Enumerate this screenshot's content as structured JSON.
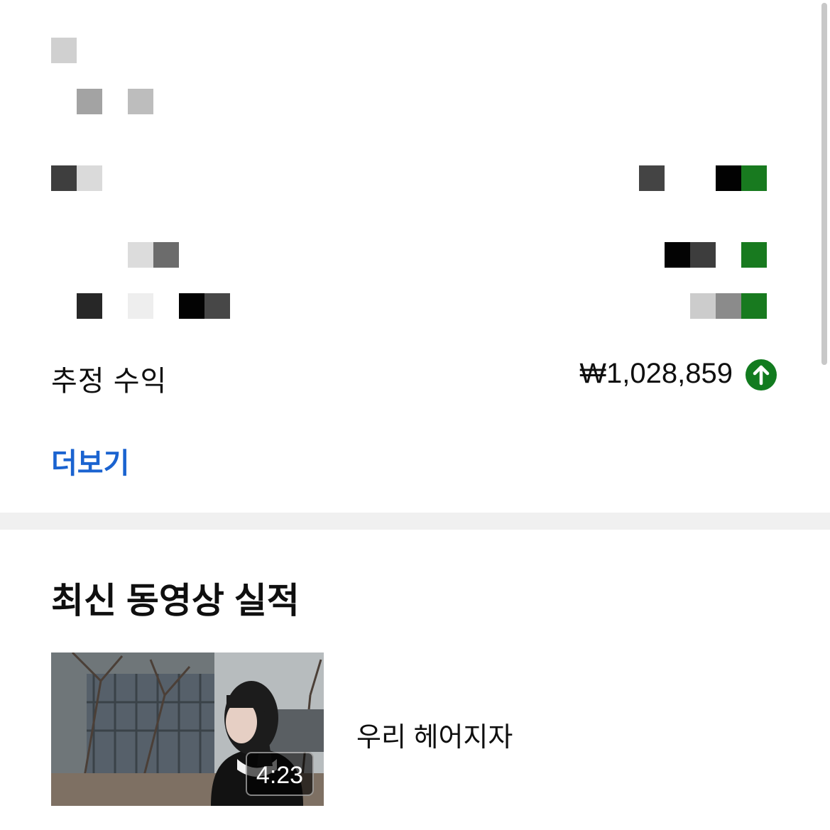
{
  "stats": {
    "estimated_revenue_label": "추정 수익",
    "estimated_revenue_value": "₩1,028,859",
    "trend": "up",
    "trend_color": "#127b1f",
    "more_label": "더보기",
    "more_color": "#1a63d0"
  },
  "latest_video": {
    "section_title": "최신 동영상 실적",
    "title": "우리 헤어지자",
    "duration": "4:23"
  },
  "icons": {
    "trend": "arrow-up-circle-icon"
  }
}
